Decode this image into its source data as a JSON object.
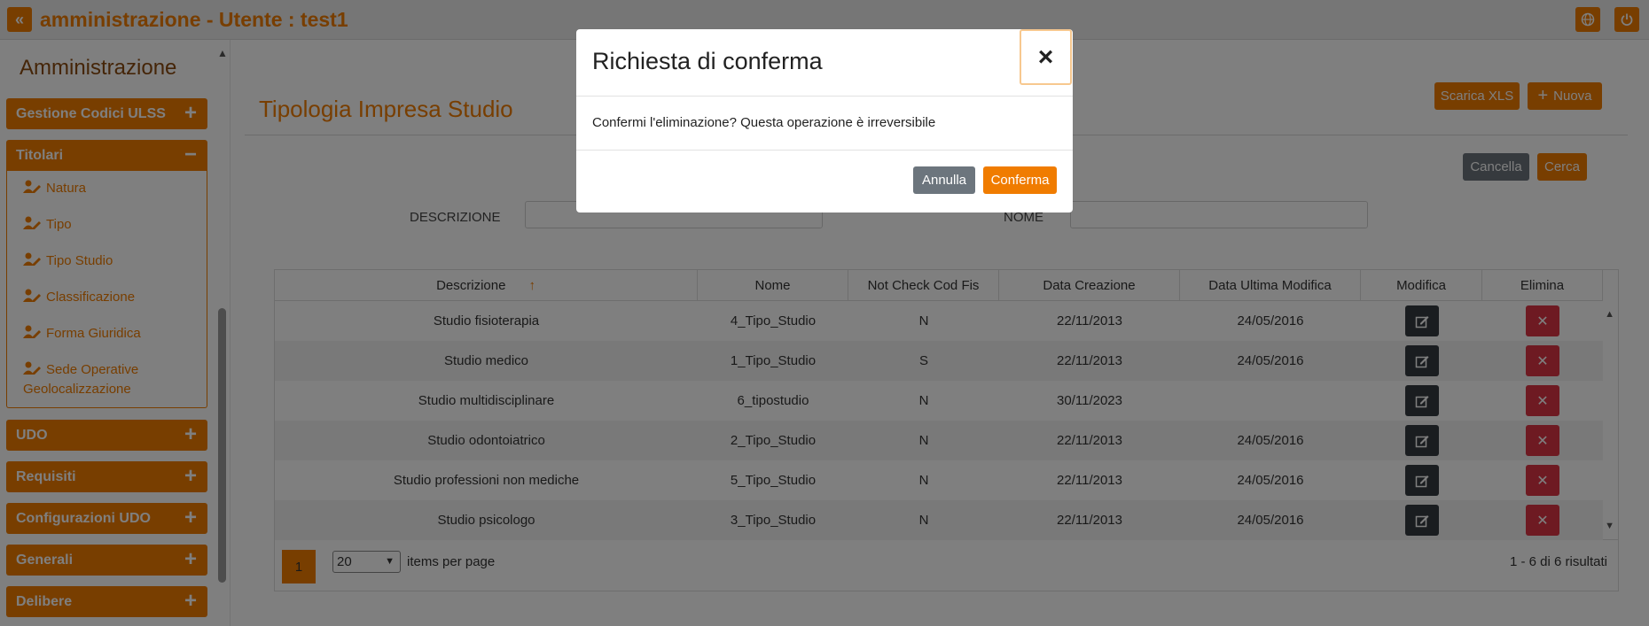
{
  "topbar": {
    "title": "amministrazione - Utente : test1",
    "back_icon": "double-chevron-left-icon",
    "globe_icon": "globe-icon",
    "power_icon": "power-icon"
  },
  "sidebar": {
    "title": "Amministrazione",
    "sections": [
      {
        "label": "Gestione Codici ULSS",
        "toggle": "+"
      },
      {
        "label": "Titolari",
        "toggle": "−"
      },
      {
        "label": "UDO",
        "toggle": "+"
      },
      {
        "label": "Requisiti",
        "toggle": "+"
      },
      {
        "label": "Configurazioni UDO",
        "toggle": "+"
      },
      {
        "label": "Generali",
        "toggle": "+"
      },
      {
        "label": "Delibere",
        "toggle": "+"
      }
    ],
    "titolari_items": [
      {
        "label": "Natura"
      },
      {
        "label": "Tipo"
      },
      {
        "label": "Tipo Studio"
      },
      {
        "label": "Classificazione"
      },
      {
        "label": "Forma Giuridica"
      },
      {
        "label": "Sede Operative"
      },
      {
        "label": "Geolocalizzazione"
      }
    ]
  },
  "main": {
    "title": "Tipologia Impresa Studio",
    "scarica_label": "Scarica XLS",
    "nuova_label": "Nuova",
    "cancella_label": "Cancella",
    "cerca_label": "Cerca",
    "filter_descrizione": "DESCRIZIONE",
    "filter_nome": "NOME"
  },
  "table": {
    "headers": [
      "Descrizione",
      "Nome",
      "Not Check Cod Fis",
      "Data Creazione",
      "Data Ultima Modifica",
      "Modifica",
      "Elimina"
    ],
    "sort_icon": "↑",
    "rows": [
      {
        "descrizione": "Studio fisioterapia",
        "nome": "4_Tipo_Studio",
        "check": "N",
        "creazione": "22/11/2013",
        "modifica": "24/05/2016"
      },
      {
        "descrizione": "Studio medico",
        "nome": "1_Tipo_Studio",
        "check": "S",
        "creazione": "22/11/2013",
        "modifica": "24/05/2016"
      },
      {
        "descrizione": "Studio multidisciplinare",
        "nome": "6_tipostudio",
        "check": "N",
        "creazione": "30/11/2023",
        "modifica": ""
      },
      {
        "descrizione": "Studio odontoiatrico",
        "nome": "2_Tipo_Studio",
        "check": "N",
        "creazione": "22/11/2013",
        "modifica": "24/05/2016"
      },
      {
        "descrizione": "Studio professioni non mediche",
        "nome": "5_Tipo_Studio",
        "check": "N",
        "creazione": "22/11/2013",
        "modifica": "24/05/2016"
      },
      {
        "descrizione": "Studio psicologo",
        "nome": "3_Tipo_Studio",
        "check": "N",
        "creazione": "22/11/2013",
        "modifica": "24/05/2016"
      }
    ]
  },
  "pager": {
    "page": "1",
    "page_size": "20",
    "per_page_label": "items per page",
    "results": "1 - 6 di 6 risultati"
  },
  "modal": {
    "title": "Richiesta di conferma",
    "close": "×",
    "body": "Confermi l'eliminazione? Questa operazione è irreversibile",
    "annulla_label": "Annulla",
    "conferma_label": "Conferma"
  },
  "colors": {
    "accent": "#f07c00",
    "danger": "#dc3545",
    "dark": "#343a40",
    "grey": "#6c757d"
  }
}
